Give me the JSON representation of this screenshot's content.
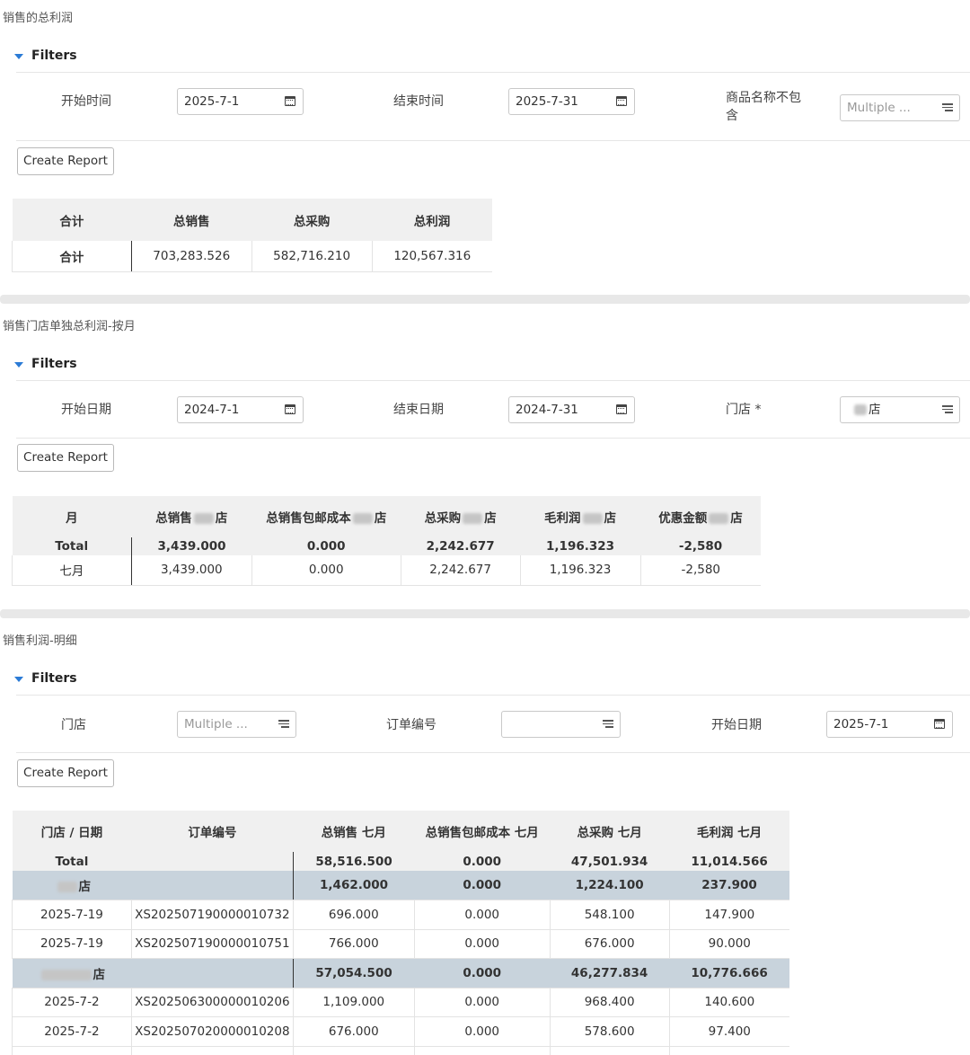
{
  "section1": {
    "title": "销售的总利润",
    "filters_label": "Filters",
    "start_label": "开始时间",
    "start_value": "2025-7-1",
    "end_label": "结束时间",
    "end_value": "2025-7-31",
    "exclude_label": "商品名称不包含",
    "exclude_placeholder": "Multiple ...",
    "create_button": "Create Report",
    "table": {
      "headers": [
        "合计",
        "总销售",
        "总采购",
        "总利润"
      ],
      "row": [
        "合计",
        "703,283.526",
        "582,716.210",
        "120,567.316"
      ]
    }
  },
  "section2": {
    "title": "销售门店单独总利润-按月",
    "filters_label": "Filters",
    "start_label": "开始日期",
    "start_value": "2024-7-1",
    "end_label": "结束日期",
    "end_value": "2024-7-31",
    "store_label": "门店 *",
    "store_value": "店",
    "create_button": "Create Report",
    "table": {
      "headers": [
        "月",
        "总销售",
        "总销售包邮成本",
        "总采购",
        "毛利润",
        "优惠金额"
      ],
      "header_suffix": "店",
      "total": [
        "Total",
        "3,439.000",
        "0.000",
        "2,242.677",
        "1,196.323",
        "-2,580"
      ],
      "row": [
        "七月",
        "3,439.000",
        "0.000",
        "2,242.677",
        "1,196.323",
        "-2,580"
      ]
    }
  },
  "section3": {
    "title": "销售利润-明细",
    "filters_label": "Filters",
    "store_label": "门店",
    "store_placeholder": "Multiple ...",
    "order_label": "订单编号",
    "order_value": "",
    "start_label": "开始日期",
    "start_value": "2025-7-1",
    "create_button": "Create Report",
    "table": {
      "headers": [
        "门店 / 日期",
        "订单编号",
        "总销售 七月",
        "总销售包邮成本 七月",
        "总采购 七月",
        "毛利润 七月"
      ],
      "total": [
        "Total",
        "",
        "58,516.500",
        "0.000",
        "47,501.934",
        "11,014.566"
      ],
      "groups": [
        {
          "name": "店",
          "values": [
            "1,462.000",
            "0.000",
            "1,224.100",
            "237.900"
          ],
          "rows": [
            [
              "2025-7-19",
              "XS202507190000010732",
              "696.000",
              "0.000",
              "548.100",
              "147.900"
            ],
            [
              "2025-7-19",
              "XS202507190000010751",
              "766.000",
              "0.000",
              "676.000",
              "90.000"
            ]
          ]
        },
        {
          "name": "店",
          "values": [
            "57,054.500",
            "0.000",
            "46,277.834",
            "10,776.666"
          ],
          "rows": [
            [
              "2025-7-2",
              "XS202506300000010206",
              "1,109.000",
              "0.000",
              "968.400",
              "140.600"
            ],
            [
              "2025-7-2",
              "XS202507020000010208",
              "676.000",
              "0.000",
              "578.600",
              "97.400"
            ]
          ]
        }
      ]
    }
  }
}
